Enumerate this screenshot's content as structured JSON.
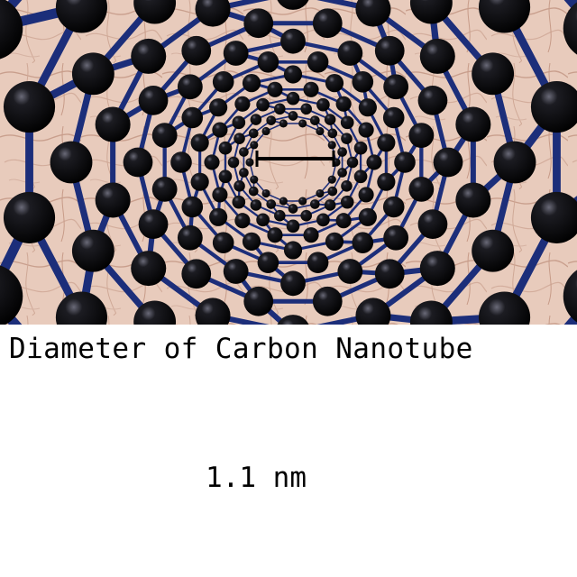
{
  "illustration": {
    "subject": "carbon-nanotube",
    "colors": {
      "background": "#e8cbbc",
      "texture": "#c99f8d",
      "atom": "#0b0b0f",
      "bond": "#1c2e7a"
    }
  },
  "caption": "Diameter of Carbon Nanotube",
  "measurement": {
    "value": "1.1 nm"
  }
}
